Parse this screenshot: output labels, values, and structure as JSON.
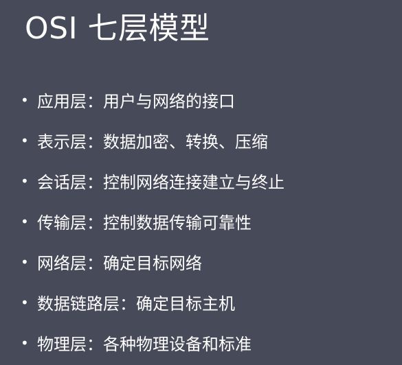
{
  "slide": {
    "title": "OSI 七层模型",
    "bullet_symbol": "•",
    "items": [
      {
        "text": "应用层：用户与网络的接口"
      },
      {
        "text": "表示层：数据加密、转换、压缩"
      },
      {
        "text": "会话层：控制网络连接建立与终止"
      },
      {
        "text": "传输层：控制数据传输可靠性"
      },
      {
        "text": "网络层：确定目标网络"
      },
      {
        "text": "数据链路层：确定目标主机"
      },
      {
        "text": "物理层：各种物理设备和标准"
      }
    ]
  },
  "colors": {
    "background": "#474a59",
    "text": "#ffffff"
  }
}
